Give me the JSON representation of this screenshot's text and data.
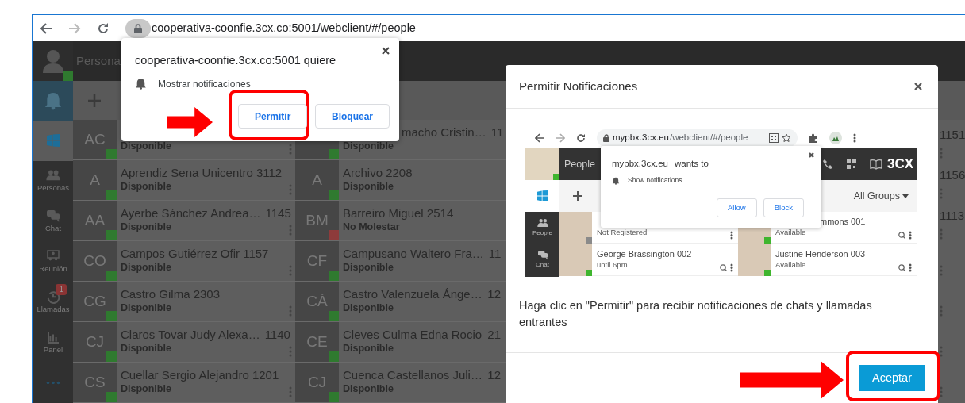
{
  "browser": {
    "url": "cooperativa-coonfie.3cx.co:5001/webclient/#/people"
  },
  "app": {
    "header_title": "Persona",
    "sidebar": [
      {
        "kind": "notifications"
      },
      {
        "kind": "windows"
      },
      {
        "kind": "people",
        "label": "Personas"
      },
      {
        "kind": "chat",
        "label": "Chat"
      },
      {
        "kind": "meeting",
        "label": "Reunión"
      },
      {
        "kind": "calls",
        "label": "Llamadas",
        "badge": "1"
      },
      {
        "kind": "panel",
        "label": "Panel"
      },
      {
        "kind": "more"
      }
    ],
    "contact_columns": [
      {
        "rows": [
          {
            "initials": "AC",
            "status": "Disponible",
            "color": "#2f7a2f"
          },
          {
            "initials": "A",
            "name": "Aprendiz Sena Unicentro 3112",
            "status": "Disponible",
            "color": "#2f7a2f"
          },
          {
            "initials": "AA",
            "name": "Ayerbe Sánchez Andrea…",
            "extension": "1145",
            "status": "Disponible",
            "color": "#2f7a2f"
          },
          {
            "initials": "CO",
            "name": "Campos Gutiérrez Ofir 1157",
            "status": "Disponible",
            "color": "#2f7a2f"
          },
          {
            "initials": "CG",
            "name": "Castro Gilma 2303",
            "status": "Disponible",
            "color": "#2f7a2f"
          },
          {
            "initials": "CJ",
            "name": "Claros Tovar Judy Alexa…",
            "extension": "1140",
            "status": "Disponible",
            "color": "#2f7a2f"
          },
          {
            "initials": "CS",
            "name": "Cuellar Sergio Alejandro 1201",
            "status": "Disponible",
            "color": "#2f7a2f"
          }
        ]
      },
      {
        "rows": [
          {
            "name": "macho Cristin…",
            "extension": "11",
            "status": "Disponible",
            "color": "#2f7a2f"
          },
          {
            "initials": "A",
            "name": "Archivo 2208",
            "status": "Disponible",
            "color": "#2f7a2f"
          },
          {
            "initials": "BM",
            "name": "Barreiro Miguel 2514",
            "status": "No Molestar",
            "color": "#8e3b3b"
          },
          {
            "initials": "CF",
            "name": "Campusano Waltero Fra…",
            "extension": "11",
            "status": "Disponible",
            "color": "#2f7a2f"
          },
          {
            "initials": "CÁ",
            "name": "Castro Valenzuela Ánge…",
            "extension": "12",
            "status": "Disponible",
            "color": "#2f7a2f"
          },
          {
            "initials": "CE",
            "name": "Cleves Culma Edna Rocio",
            "extension": "21",
            "status": "Disponible",
            "color": "#2f7a2f"
          },
          {
            "initials": "CJ",
            "name": "Cuenca Castellanos Juli…",
            "extension": "12",
            "status": "Disponible",
            "color": "#2f7a2f"
          }
        ]
      },
      {
        "rows": [
          {
            "extension": "1151"
          },
          {
            "extension": "1156"
          },
          {
            "extension": "1113"
          },
          {},
          {},
          {},
          {}
        ]
      }
    ]
  },
  "permission_popup": {
    "message": "cooperativa-coonfie.3cx.co:5001 quiere",
    "permission": "Mostrar notificaciones",
    "buttons": [
      "Permitir",
      "Bloquear"
    ]
  },
  "modal": {
    "title": "Permitir Notificaciones",
    "example": {
      "url_host": "mypbx.3cx.eu",
      "url_path": "/webclient/#/people",
      "header_title": "People",
      "logo": "3CX",
      "groups": "All Groups",
      "sidebar": [
        {
          "kind": "people",
          "label": "People"
        },
        {
          "kind": "chat",
          "label": "Chat"
        }
      ],
      "contact_rows": [
        [
          {
            "status": "Not Registered",
            "color": "#8a8a8a"
          },
          {
            "name": "mmons 001",
            "status": "Available",
            "color": "#3fb52e"
          }
        ],
        [
          {
            "name": "George Brassington 002",
            "status": "until 6pm",
            "color": "#3fb52e"
          },
          {
            "name": "Justine Henderson 003",
            "status": "Available",
            "color": "#3fb52e"
          }
        ]
      ],
      "popup": {
        "site": "mypbx.3cx.eu",
        "request": "wants to",
        "permission": "Show notifications",
        "buttons": [
          "Allow",
          "Block"
        ]
      }
    },
    "message": "Haga clic en \"Permitir\" para recibir notificaciones de chats y llamadas entrantes",
    "button": "Aceptar"
  }
}
